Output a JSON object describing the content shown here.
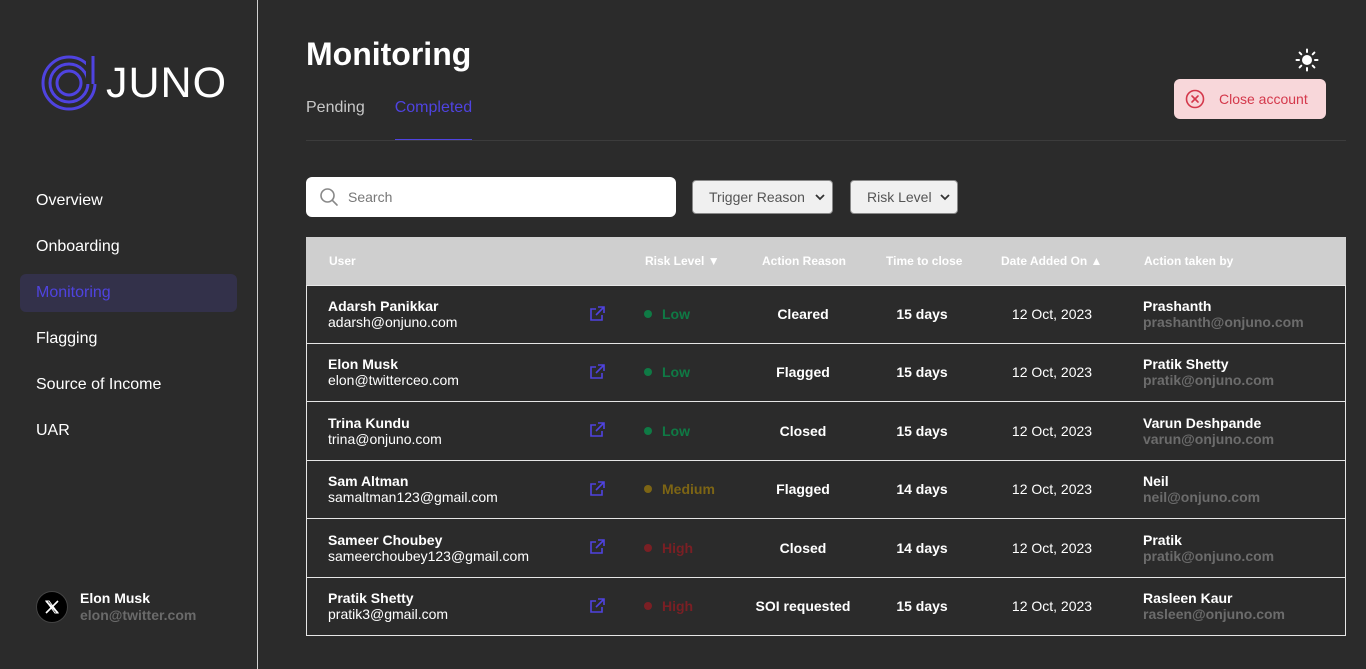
{
  "brand": {
    "name": "JUNO"
  },
  "sidebar": {
    "items": [
      {
        "label": "Overview",
        "active": false
      },
      {
        "label": "Onboarding",
        "active": false
      },
      {
        "label": "Monitoring",
        "active": true
      },
      {
        "label": "Flagging",
        "active": false
      },
      {
        "label": "Source of Income",
        "active": false
      },
      {
        "label": "UAR",
        "active": false
      }
    ],
    "profile": {
      "name": "Elon Musk",
      "email": "elon@twitter.com",
      "avatar_icon": "x-logo-icon"
    }
  },
  "header": {
    "title": "Monitoring",
    "tabs": [
      {
        "label": "Pending",
        "active": false
      },
      {
        "label": "Completed",
        "active": true
      }
    ],
    "theme_icon": "sun-icon",
    "close_account_label": "Close account"
  },
  "filters": {
    "search_placeholder": "Search",
    "trigger_reason": "Trigger Reason",
    "risk_level": "Risk Level"
  },
  "table": {
    "headers": {
      "user": "User",
      "risk": "Risk Level ▼",
      "reason": "Action Reason",
      "time": "Time to close",
      "date": "Date Added On ▲",
      "by": "Action taken by"
    },
    "rows": [
      {
        "name": "Adarsh Panikkar",
        "email": "adarsh@onjuno.com",
        "risk": "Low",
        "reason": "Cleared",
        "time": "15 days",
        "date": "12 Oct, 2023",
        "by_name": "Prashanth",
        "by_email": "prashanth@onjuno.com"
      },
      {
        "name": "Elon Musk",
        "email": "elon@twitterceo.com",
        "risk": "Low",
        "reason": "Flagged",
        "time": "15 days",
        "date": "12 Oct, 2023",
        "by_name": "Pratik Shetty",
        "by_email": "pratik@onjuno.com"
      },
      {
        "name": "Trina Kundu",
        "email": "trina@onjuno.com",
        "risk": "Low",
        "reason": "Closed",
        "time": "15 days",
        "date": "12 Oct, 2023",
        "by_name": "Varun Deshpande",
        "by_email": "varun@onjuno.com"
      },
      {
        "name": "Sam Altman",
        "email": "samaltman123@gmail.com",
        "risk": "Medium",
        "reason": "Flagged",
        "time": "14 days",
        "date": "12 Oct, 2023",
        "by_name": "Neil",
        "by_email": "neil@onjuno.com"
      },
      {
        "name": "Sameer Choubey",
        "email": "sameerchoubey123@gmail.com",
        "risk": "High",
        "reason": "Closed",
        "time": "14 days",
        "date": "12 Oct, 2023",
        "by_name": "Pratik",
        "by_email": "pratik@onjuno.com"
      },
      {
        "name": "Pratik Shetty",
        "email": "pratik3@gmail.com",
        "risk": "High",
        "reason": "SOI requested",
        "time": "15 days",
        "date": "12 Oct, 2023",
        "by_name": "Rasleen Kaur",
        "by_email": "rasleen@onjuno.com"
      }
    ]
  },
  "colors": {
    "accent": "#4f43e0",
    "risk_low": "#0f7a45",
    "risk_medium": "#7d6514",
    "risk_high": "#7a1f24",
    "close_bg": "#f8d7da",
    "close_text": "#d4384b"
  }
}
